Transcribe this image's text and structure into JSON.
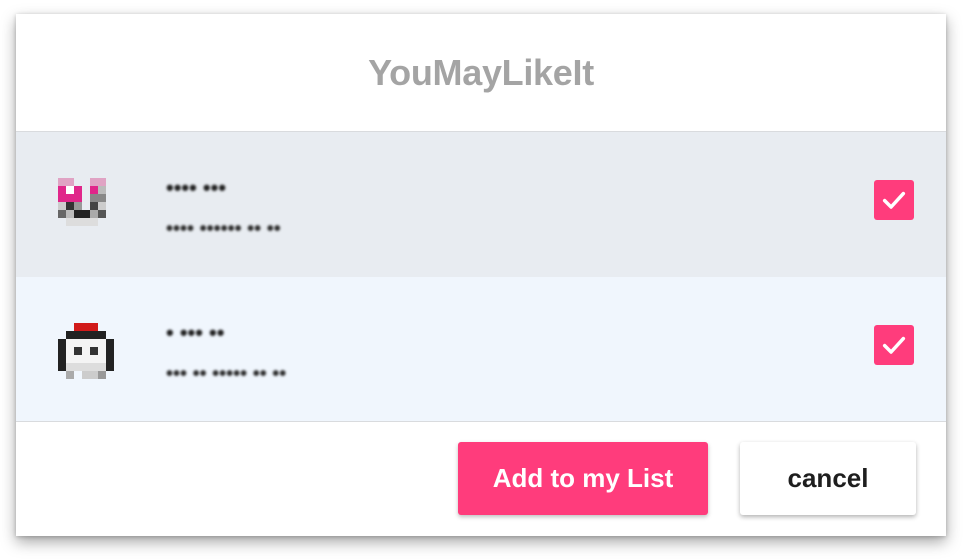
{
  "dialog": {
    "title": "YouMayLikeIt",
    "accent_color": "#ff3c7c",
    "items": [
      {
        "name": "•••• •••",
        "subtitle": "•••• •••••• •• ••",
        "avatar_icon": "pixel-art-avatar-pink",
        "checked": true
      },
      {
        "name": "• ••• ••",
        "subtitle": "••• •• ••••• •• ••",
        "avatar_icon": "pixel-art-avatar-red",
        "checked": true
      }
    ],
    "buttons": {
      "add_label": "Add to my List",
      "cancel_label": "cancel"
    }
  }
}
